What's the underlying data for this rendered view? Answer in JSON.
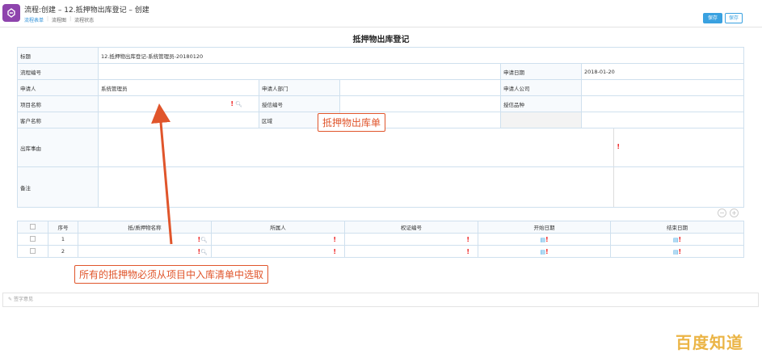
{
  "header": {
    "title": "流程:创建 – 12.抵押物出库登记 – 创建",
    "tabs": [
      "流程表单",
      "流程图",
      "流程状态"
    ],
    "save_label": "保存",
    "other_label": "保存"
  },
  "form": {
    "title": "抵押物出库登记",
    "title_label": "标题",
    "title_value": "12.抵押物出库登记-系统管理员-20180120",
    "flow_no_label": "流程编号",
    "apply_date_label": "申请日期",
    "apply_date_value": "2018-01-20",
    "applicant_label": "申请人",
    "applicant_value": "系统管理员",
    "applicant_dept_label": "申请人部门",
    "applicant_company_label": "申请人公司",
    "project_name_label": "项目名称",
    "credit_no_label": "授信编号",
    "credit_type_label": "授信品种",
    "customer_name_label": "客户名称",
    "region_label": "区域",
    "reason_label": "出库事由",
    "remark_label": "备注"
  },
  "detail": {
    "headers": [
      "序号",
      "抵/质押物名称",
      "所属人",
      "权证编号",
      "开始日期",
      "结束日期"
    ],
    "rows": [
      {
        "no": "1"
      },
      {
        "no": "2"
      }
    ]
  },
  "annotations": {
    "top": "抵押物出库单",
    "bottom": "所有的抵押物必须从项目中入库清单中选取"
  },
  "sign_bar": {
    "placeholder": "签字意见"
  },
  "watermark": "百度知道",
  "colors": {
    "accent": "#39a1e0",
    "annotation": "#e0552b",
    "required": "#e22222"
  }
}
